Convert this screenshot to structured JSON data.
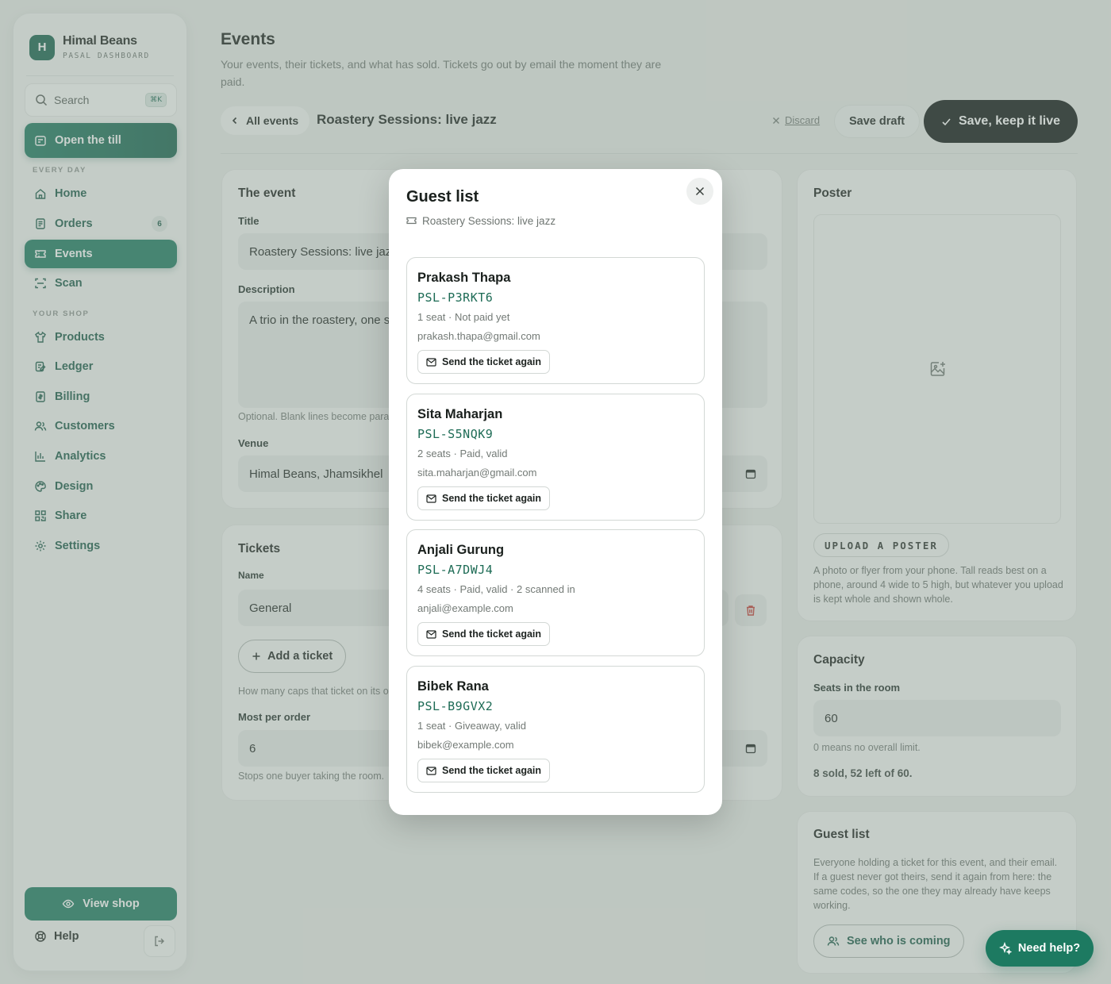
{
  "brand": {
    "initial": "H",
    "name": "Himal Beans",
    "sub": "PASAL DASHBOARD"
  },
  "search": {
    "label": "Search",
    "shortcut": "⌘K"
  },
  "open_till": {
    "label": "Open the till"
  },
  "sections": {
    "every_day": "EVERY DAY",
    "your_shop": "YOUR SHOP"
  },
  "nav": {
    "home": "Home",
    "orders": "Orders",
    "orders_badge": "6",
    "events": "Events",
    "scan": "Scan",
    "products": "Products",
    "ledger": "Ledger",
    "billing": "Billing",
    "customers": "Customers",
    "analytics": "Analytics",
    "design": "Design",
    "share": "Share",
    "settings": "Settings"
  },
  "view_shop": "View shop",
  "help": "Help",
  "page": {
    "title": "Events",
    "subtitle": "Your events, their tickets, and what has sold. Tickets go out by email the moment they are paid."
  },
  "toolbar": {
    "back": "All events",
    "event_name": "Roastery Sessions: live jazz",
    "discard": "Discard",
    "save_draft": "Save draft",
    "save_live": "Save, keep it live"
  },
  "event_card": {
    "title": "The event",
    "title_label": "Title",
    "title_value": "Roastery Sessions: live jazz",
    "description_label": "Description",
    "description_value": "A trio in the roastery, one s",
    "description_hint": "Optional. Blank lines become para",
    "venue_label": "Venue",
    "venue_value": "Himal Beans, Jhamsikhel"
  },
  "tickets_card": {
    "title": "Tickets",
    "name_label": "Name",
    "name_value": "General",
    "add_ticket": "Add a ticket",
    "caps_hint": "How many caps that ticket on its o",
    "most_label": "Most per order",
    "most_value": "6",
    "most_hint": "Stops one buyer taking the room."
  },
  "poster_card": {
    "title": "Poster",
    "upload": "UPLOAD A POSTER",
    "hint": "A photo or flyer from your phone. Tall reads best on a phone, around 4 wide to 5 high, but whatever you upload is kept whole and shown whole."
  },
  "capacity_card": {
    "title": "Capacity",
    "seats_label": "Seats in the room",
    "seats_value": "60",
    "hint": "0 means no overall limit.",
    "sold": "8 sold, 52 left of 60."
  },
  "guestlist_card": {
    "title": "Guest list",
    "text": "Everyone holding a ticket for this event, and their email. If a guest never got theirs, send it again from here: the same codes, so the one they may already have keeps working.",
    "button": "See who is coming"
  },
  "need_help": "Need help?",
  "modal": {
    "title": "Guest list",
    "subtitle": "Roastery Sessions: live jazz",
    "guests": [
      {
        "name": "Prakash Thapa",
        "code": "PSL-P3RKT6",
        "meta": "1 seat · Not paid yet",
        "email": "prakash.thapa@gmail.com",
        "send": "Send the ticket again"
      },
      {
        "name": "Sita Maharjan",
        "code": "PSL-S5NQK9",
        "meta": "2 seats · Paid, valid",
        "email": "sita.maharjan@gmail.com",
        "send": "Send the ticket again"
      },
      {
        "name": "Anjali Gurung",
        "code": "PSL-A7DWJ4",
        "meta": "4 seats · Paid, valid · 2 scanned in",
        "email": "anjali@example.com",
        "send": "Send the ticket again"
      },
      {
        "name": "Bibek Rana",
        "code": "PSL-B9GVX2",
        "meta": "1 seat · Giveaway, valid",
        "email": "bibek@example.com",
        "send": "Send the ticket again"
      }
    ]
  }
}
